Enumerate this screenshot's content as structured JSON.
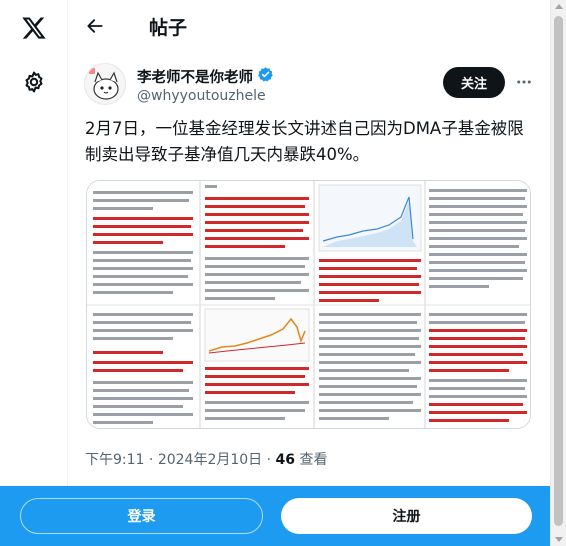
{
  "nav": {
    "logo_icon": "x-logo-icon",
    "settings_icon": "gear-icon"
  },
  "header": {
    "back_icon": "arrow-left-icon",
    "title": "帖子"
  },
  "author": {
    "name": "李老师不是你老师",
    "handle": "@whyyoutouzhele",
    "verified_icon": "verified-badge-icon",
    "follow_label": "关注",
    "more_icon": "more-horizontal-icon"
  },
  "tweet": {
    "text": "2月7日，一位基金经理发长文讲述自己因为DMA子基金被限制卖出导致子基净值几天内暴跌40%。",
    "time": "下午9:11",
    "date": "2024年2月10日",
    "separator": "·",
    "views_count": "46",
    "views_label": "查看"
  },
  "bottom_bar": {
    "login_label": "登录",
    "signup_label": "注册"
  },
  "colors": {
    "accent": "#1d9bf0",
    "text": "#0f1419",
    "secondary": "#536471",
    "verified": "#1d9bf0"
  }
}
